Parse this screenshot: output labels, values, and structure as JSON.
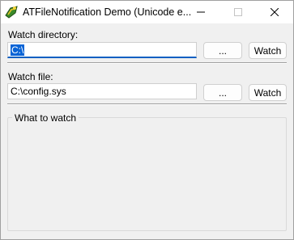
{
  "window": {
    "title": "ATFileNotification Demo (Unicode e..."
  },
  "watch_directory": {
    "label": "Watch directory:",
    "value": "C:\\",
    "browse_label": "...",
    "watch_label": "Watch"
  },
  "watch_file": {
    "label": "Watch file:",
    "value": "C:\\config.sys",
    "browse_label": "...",
    "watch_label": "Watch"
  },
  "what_to_watch": {
    "label": "What to watch"
  },
  "colors": {
    "accent": "#0a64d6",
    "background": "#f0f0f0"
  }
}
